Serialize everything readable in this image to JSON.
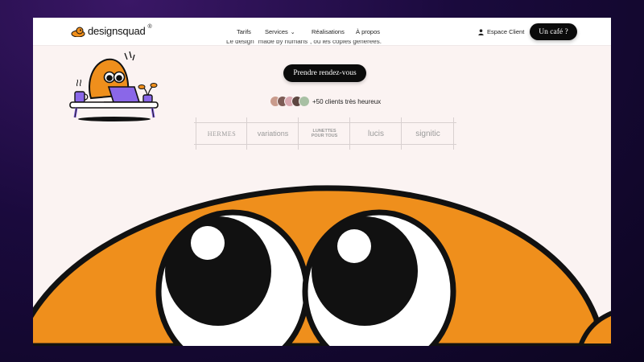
{
  "header": {
    "logo_text": "designsquad",
    "logo_sup": "®",
    "nav": [
      {
        "label": "Tarifs"
      },
      {
        "label": "Services",
        "has_dropdown": true
      },
      {
        "label": "Réalisations"
      },
      {
        "label": "À propos"
      }
    ],
    "espace_client": "Espace Client",
    "cta": "Un café ?"
  },
  "hero": {
    "cut_text": "Le design \"made by humans\", où les copies générées.",
    "primary_button": "Prendre rendez-vous",
    "clients_text": "+50 clients très heureux"
  },
  "client_logos": [
    {
      "name": "HERMES"
    },
    {
      "name": "variations"
    },
    {
      "name": "LUNETTES POUR TOUS"
    },
    {
      "name": "lucis"
    },
    {
      "name": "signitic"
    }
  ],
  "colors": {
    "accent_orange": "#ef8f1c",
    "laptop_purple": "#8a67e8",
    "page_bg": "#fbf3f2",
    "button_bg": "#0b0b0b"
  }
}
